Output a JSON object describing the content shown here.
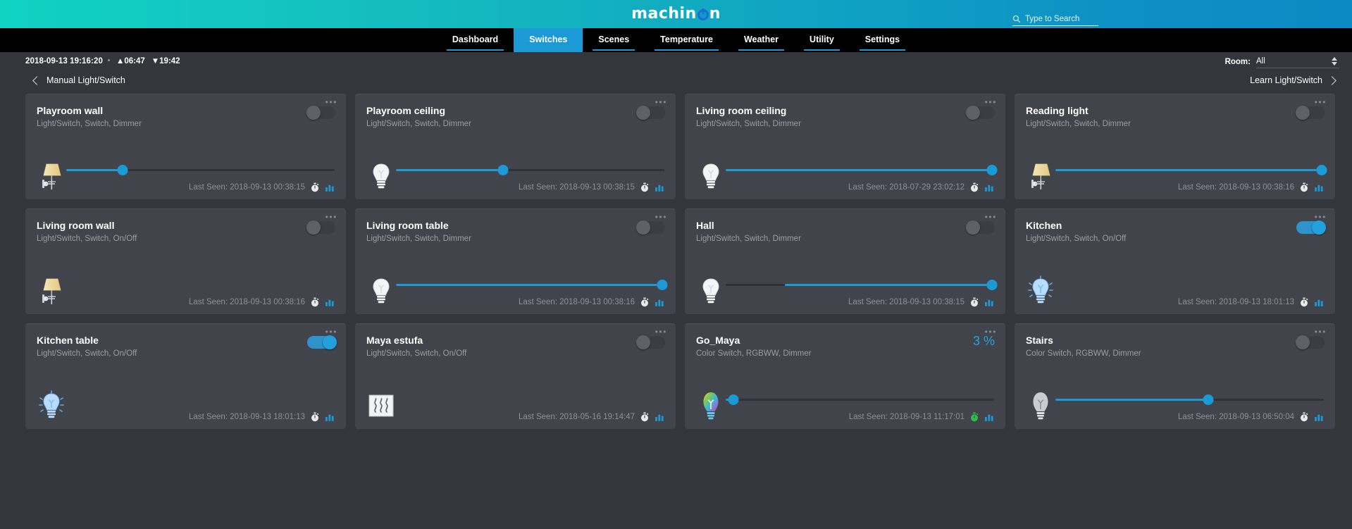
{
  "brand": {
    "name_pre": "machin",
    "name_post": "n",
    "logo_icon": "machinon-logo"
  },
  "search": {
    "placeholder": "Type to Search",
    "value": "",
    "icon": "search-icon"
  },
  "nav": {
    "items": [
      {
        "label": "Dashboard",
        "active": false
      },
      {
        "label": "Switches",
        "active": true
      },
      {
        "label": "Scenes",
        "active": false
      },
      {
        "label": "Temperature",
        "active": false
      },
      {
        "label": "Weather",
        "active": false
      },
      {
        "label": "Utility",
        "active": false
      },
      {
        "label": "Settings",
        "active": false
      }
    ]
  },
  "status": {
    "datetime": "2018-09-13 19:16:20",
    "sunrise": "▲06:47",
    "sunset": "▼19:42",
    "room_label": "Room:",
    "room_value": "All"
  },
  "section": {
    "back_label": "Manual Light/Switch",
    "forward_label": "Learn Light/Switch",
    "back_icon": "chevron-left-icon",
    "forward_icon": "chevron-right-icon"
  },
  "labels": {
    "last_seen_prefix": "Last Seen:",
    "menu_dots": "•••",
    "timer_icon": "stopwatch-icon",
    "chart_icon": "bar-chart-icon"
  },
  "colors": {
    "accent": "#1b9ad6",
    "accent_text": "#25a3de",
    "card_bg": "#41454b",
    "page_bg": "#33363b",
    "timer_green": "#2fc04b",
    "timer_grey": "#e8eaec"
  },
  "cards": [
    {
      "title": "Playroom wall",
      "subtitle": "Light/Switch, Switch, Dimmer",
      "control": "toggle",
      "toggle_on": false,
      "icon": "wall-lamp-icon",
      "icon_state": "warm",
      "has_slider": true,
      "slider_pct": 21,
      "slider_offset_pct": 0,
      "last_seen": "2018-09-13 00:38:15",
      "timer_color": "grey"
    },
    {
      "title": "Playroom ceiling",
      "subtitle": "Light/Switch, Switch, Dimmer",
      "control": "toggle",
      "toggle_on": false,
      "icon": "bulb-icon",
      "icon_state": "off",
      "has_slider": true,
      "slider_pct": 40,
      "slider_offset_pct": 0,
      "last_seen": "2018-09-13 00:38:15",
      "timer_color": "grey"
    },
    {
      "title": "Living room ceiling",
      "subtitle": "Light/Switch, Switch, Dimmer",
      "control": "toggle",
      "toggle_on": false,
      "icon": "bulb-icon",
      "icon_state": "off",
      "has_slider": true,
      "slider_pct": 100,
      "slider_offset_pct": 0,
      "last_seen": "2018-07-29 23:02:12",
      "timer_color": "grey"
    },
    {
      "title": "Reading light",
      "subtitle": "Light/Switch, Switch, Dimmer",
      "control": "toggle",
      "toggle_on": false,
      "icon": "wall-lamp-icon",
      "icon_state": "warm",
      "has_slider": true,
      "slider_pct": 100,
      "slider_offset_pct": 0,
      "last_seen": "2018-09-13 00:38:16",
      "timer_color": "grey"
    },
    {
      "title": "Living room wall",
      "subtitle": "Light/Switch, Switch, On/Off",
      "control": "toggle",
      "toggle_on": false,
      "icon": "wall-lamp-icon",
      "icon_state": "warm",
      "has_slider": false,
      "slider_pct": 0,
      "slider_offset_pct": 0,
      "last_seen": "2018-09-13 00:38:16",
      "timer_color": "grey"
    },
    {
      "title": "Living room table",
      "subtitle": "Light/Switch, Switch, Dimmer",
      "control": "toggle",
      "toggle_on": false,
      "icon": "bulb-icon",
      "icon_state": "off",
      "has_slider": true,
      "slider_pct": 100,
      "slider_offset_pct": 0,
      "last_seen": "2018-09-13 00:38:16",
      "timer_color": "grey"
    },
    {
      "title": "Hall",
      "subtitle": "Light/Switch, Switch, Dimmer",
      "control": "toggle",
      "toggle_on": false,
      "icon": "bulb-icon",
      "icon_state": "off",
      "has_slider": true,
      "slider_pct": 100,
      "slider_offset_pct": 22,
      "last_seen": "2018-09-13 00:38:15",
      "timer_color": "grey"
    },
    {
      "title": "Kitchen",
      "subtitle": "Light/Switch, Switch, On/Off",
      "control": "toggle",
      "toggle_on": true,
      "icon": "bulb-icon",
      "icon_state": "on-blue",
      "has_slider": false,
      "slider_pct": 0,
      "slider_offset_pct": 0,
      "last_seen": "2018-09-13 18:01:13",
      "timer_color": "grey"
    },
    {
      "title": "Kitchen table",
      "subtitle": "Light/Switch, Switch, On/Off",
      "control": "toggle",
      "toggle_on": true,
      "icon": "bulb-icon",
      "icon_state": "on-blue",
      "has_slider": false,
      "slider_pct": 0,
      "slider_offset_pct": 0,
      "last_seen": "2018-09-13 18:01:13",
      "timer_color": "grey"
    },
    {
      "title": "Maya estufa",
      "subtitle": "Light/Switch, Switch, On/Off",
      "control": "toggle",
      "toggle_on": false,
      "icon": "stove-heat-icon",
      "icon_state": "plain",
      "has_slider": false,
      "slider_pct": 0,
      "slider_offset_pct": 0,
      "last_seen": "2018-05-16 19:14:47",
      "timer_color": "grey"
    },
    {
      "title": "Go_Maya",
      "subtitle": "Color Switch, RGBWW, Dimmer",
      "control": "percent",
      "percent_label": "3 %",
      "toggle_on": false,
      "icon": "rgb-bulb-icon",
      "icon_state": "rainbow",
      "has_slider": true,
      "slider_pct": 3,
      "slider_offset_pct": 0,
      "last_seen": "2018-09-13 11:17:01",
      "timer_color": "green"
    },
    {
      "title": "Stairs",
      "subtitle": "Color Switch, RGBWW, Dimmer",
      "control": "toggle",
      "toggle_on": false,
      "icon": "rgb-bulb-icon",
      "icon_state": "grey",
      "has_slider": true,
      "slider_pct": 57,
      "slider_offset_pct": 0,
      "last_seen": "2018-09-13 06:50:04",
      "timer_color": "grey"
    }
  ]
}
